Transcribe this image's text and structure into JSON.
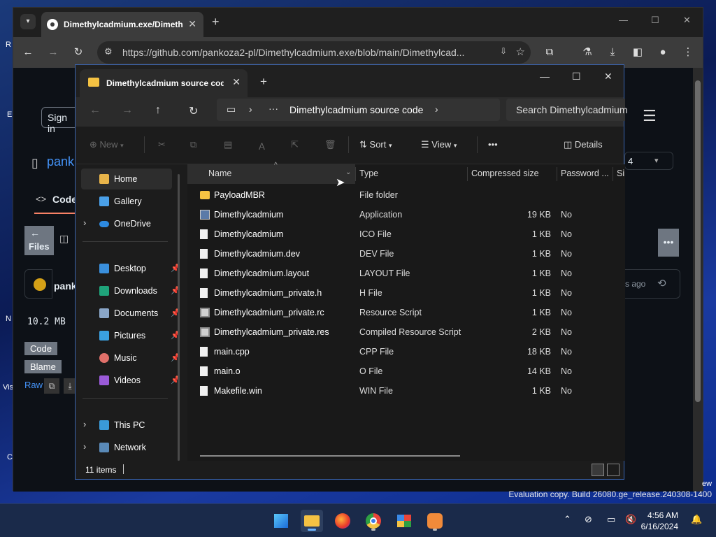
{
  "desktop": {
    "fragments": [
      "R",
      "E",
      "N",
      "Vis",
      "C",
      "ew"
    ]
  },
  "browser": {
    "tab_title": "Dimethylcadmium.exe/Dimeth",
    "url": "https://github.com/pankoza2-pl/Dimethylcadmium.exe/blob/main/Dimethylcad...",
    "page": {
      "signin": "Sign in",
      "owner_partial": "pank",
      "code_tab": "Code",
      "files_btn": "Files",
      "file_size": "10.2 MB",
      "code_btn": "Code",
      "blame_btn": "Blame",
      "raw": "Raw",
      "time_partial": "s ago",
      "branch_count": "4",
      "owner_avatar_text": "pank"
    }
  },
  "explorer": {
    "tab_title": "Dimethylcadmium source code",
    "breadcrumb": "Dimethylcadmium source code",
    "search_placeholder": "Search Dimethylcadmium",
    "commands": {
      "new": "New",
      "sort": "Sort",
      "view": "View",
      "more": "•••",
      "details": "Details"
    },
    "nav": [
      {
        "label": "Home",
        "icon": "home-icon",
        "selected": true
      },
      {
        "label": "Gallery",
        "icon": "gallery-icon"
      },
      {
        "label": "OneDrive",
        "icon": "onedrive-icon",
        "expandable": true
      },
      {
        "label": "Desktop",
        "icon": "desktop-icon",
        "pinned": true
      },
      {
        "label": "Downloads",
        "icon": "downloads-icon",
        "pinned": true
      },
      {
        "label": "Documents",
        "icon": "documents-icon",
        "pinned": true
      },
      {
        "label": "Pictures",
        "icon": "pictures-icon",
        "pinned": true
      },
      {
        "label": "Music",
        "icon": "music-icon",
        "pinned": true
      },
      {
        "label": "Videos",
        "icon": "videos-icon",
        "pinned": true
      },
      {
        "label": "This PC",
        "icon": "this-pc-icon",
        "expandable": true
      },
      {
        "label": "Network",
        "icon": "network-icon",
        "expandable": true
      }
    ],
    "columns": [
      "Name",
      "Type",
      "Compressed size",
      "Password ...",
      "Si"
    ],
    "files": [
      {
        "name": "PayloadMBR",
        "type": "File folder",
        "size": "",
        "password": "",
        "icon": "folder-icon"
      },
      {
        "name": "Dimethylcadmium",
        "type": "Application",
        "size": "19 KB",
        "password": "No",
        "icon": "application-icon"
      },
      {
        "name": "Dimethylcadmium",
        "type": "ICO File",
        "size": "1 KB",
        "password": "No",
        "icon": "file-icon"
      },
      {
        "name": "Dimethylcadmium.dev",
        "type": "DEV File",
        "size": "1 KB",
        "password": "No",
        "icon": "file-icon"
      },
      {
        "name": "Dimethylcadmium.layout",
        "type": "LAYOUT File",
        "size": "1 KB",
        "password": "No",
        "icon": "file-icon"
      },
      {
        "name": "Dimethylcadmium_private.h",
        "type": "H File",
        "size": "1 KB",
        "password": "No",
        "icon": "file-icon"
      },
      {
        "name": "Dimethylcadmium_private.rc",
        "type": "Resource Script",
        "size": "1 KB",
        "password": "No",
        "icon": "resource-icon"
      },
      {
        "name": "Dimethylcadmium_private.res",
        "type": "Compiled Resource Script",
        "size": "2 KB",
        "password": "No",
        "icon": "resource-icon"
      },
      {
        "name": "main.cpp",
        "type": "CPP File",
        "size": "18 KB",
        "password": "No",
        "icon": "file-icon"
      },
      {
        "name": "main.o",
        "type": "O File",
        "size": "14 KB",
        "password": "No",
        "icon": "file-icon"
      },
      {
        "name": "Makefile.win",
        "type": "WIN File",
        "size": "1 KB",
        "password": "No",
        "icon": "file-icon"
      }
    ],
    "status": "11 items"
  },
  "watermark": "Evaluation copy. Build 26080.ge_release.240308-1400",
  "taskbar": {
    "time": "4:56 AM",
    "date": "6/16/2024"
  },
  "colors": {
    "accent": "#3a64b0",
    "folder": "#f4c243",
    "desktop_bg": "#0b1b55"
  }
}
